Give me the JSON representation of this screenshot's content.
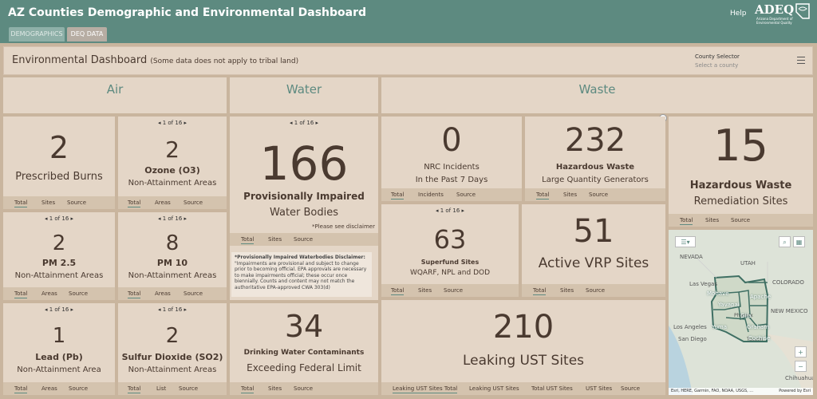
{
  "header": {
    "title": "AZ Counties Demographic and Environmental Dashboard",
    "help": "Help",
    "logo_text": "ADEQ",
    "logo_sub": "Arizona Department of Environmental Quality"
  },
  "tabs": [
    {
      "label": "DEMOGRAPHICS",
      "active": false
    },
    {
      "label": "DEQ DATA",
      "active": true
    }
  ],
  "dashboard": {
    "title": "Environmental Dashboard",
    "note": "(Some data does not apply to tribal land)",
    "county_selector_label": "County Selector",
    "county_selector_placeholder": "Select a county"
  },
  "sections": {
    "air": "Air",
    "water": "Water",
    "waste": "Waste"
  },
  "cards": {
    "burns": {
      "value": "2",
      "label": "Prescribed Burns",
      "tabs": [
        "Total",
        "Sites",
        "Source"
      ]
    },
    "ozone": {
      "pager": "1 of 16",
      "value": "2",
      "label1": "Ozone (O3)",
      "label2": "Non-Attainment Areas",
      "tabs": [
        "Total",
        "Areas",
        "Source"
      ]
    },
    "pm25": {
      "pager": "1 of 16",
      "value": "2",
      "label1": "PM 2.5",
      "label2": "Non-Attainment Areas",
      "tabs": [
        "Total",
        "Areas",
        "Source"
      ]
    },
    "pm10": {
      "pager": "1 of 16",
      "value": "8",
      "label1": "PM 10",
      "label2": "Non-Attainment Areas",
      "tabs": [
        "Total",
        "Areas",
        "Source"
      ]
    },
    "lead": {
      "pager": "1 of 16",
      "value": "1",
      "label1": "Lead (Pb)",
      "label2": "Non-Attainment Area",
      "tabs": [
        "Total",
        "Areas",
        "Source"
      ]
    },
    "so2": {
      "pager": "1 of 16",
      "value": "2",
      "label1": "Sulfur Dioxide (SO2)",
      "label2": "Non-Attainment Areas",
      "tabs": [
        "Total",
        "List",
        "Source"
      ]
    },
    "impaired": {
      "pager": "1 of 16",
      "value": "166",
      "label1": "Provisionally Impaired",
      "label2": "Water Bodies",
      "note": "*Please see disclaimer",
      "tabs": [
        "Total",
        "Sites",
        "Source"
      ],
      "disclaimer_title": "*Provisionally Impaired Waterbodies Disclaimer:",
      "disclaimer_body": "\"Impairments are provisional and subject to change prior to becoming official. EPA approvals are necessary to make impairments official; these occur once biennially. Counts and content may not match the authoritative EPA-approved CWA 303(d)"
    },
    "drinking": {
      "value": "34",
      "label1": "Drinking Water Contaminants",
      "label2": "Exceeding Federal Limit",
      "tabs": [
        "Total",
        "Sites",
        "Source"
      ]
    },
    "nrc": {
      "value": "0",
      "label1": "NRC Incidents",
      "label2": "In the Past 7 Days",
      "tabs": [
        "Total",
        "Incidents",
        "Source"
      ]
    },
    "hazwaste": {
      "value": "232",
      "label1": "Hazardous Waste",
      "label2": "Large Quantity Generators",
      "tabs": [
        "Total",
        "Sites",
        "Source"
      ]
    },
    "remediation": {
      "value": "15",
      "label1": "Hazardous Waste",
      "label2": "Remediation Sites",
      "tabs": [
        "Total",
        "Sites",
        "Source"
      ]
    },
    "superfund": {
      "pager": "1 of 16",
      "value": "63",
      "label1": "Superfund Sites",
      "label2": "WQARF, NPL and DOD",
      "tabs": [
        "Total",
        "Sites",
        "Source"
      ]
    },
    "vrp": {
      "value": "51",
      "label1": "Active VRP Sites",
      "tabs": [
        "Total",
        "Sites",
        "Source"
      ]
    },
    "ust": {
      "value": "210",
      "label1": "Leaking UST Sites",
      "tabs": [
        "Leaking UST Sites Total",
        "Leaking UST Sites",
        "Total UST Sites",
        "UST Sites",
        "Source"
      ]
    }
  },
  "map": {
    "places": [
      "NEVADA",
      "UTAH",
      "COLORADO",
      "Las Vegas",
      "NEW MEXICO",
      "Phoenix",
      "Los Angeles",
      "San Diego",
      "Tucson",
      "Chihuahua"
    ],
    "counties": [
      "Mohave",
      "Yavapai",
      "Apache",
      "Gila",
      "Yuma",
      "Graham",
      "Cochise"
    ],
    "attribution": "Esri, HERE, Garmin, FAO, NOAA, USGS, ...",
    "powered": "Powered by Esri"
  }
}
